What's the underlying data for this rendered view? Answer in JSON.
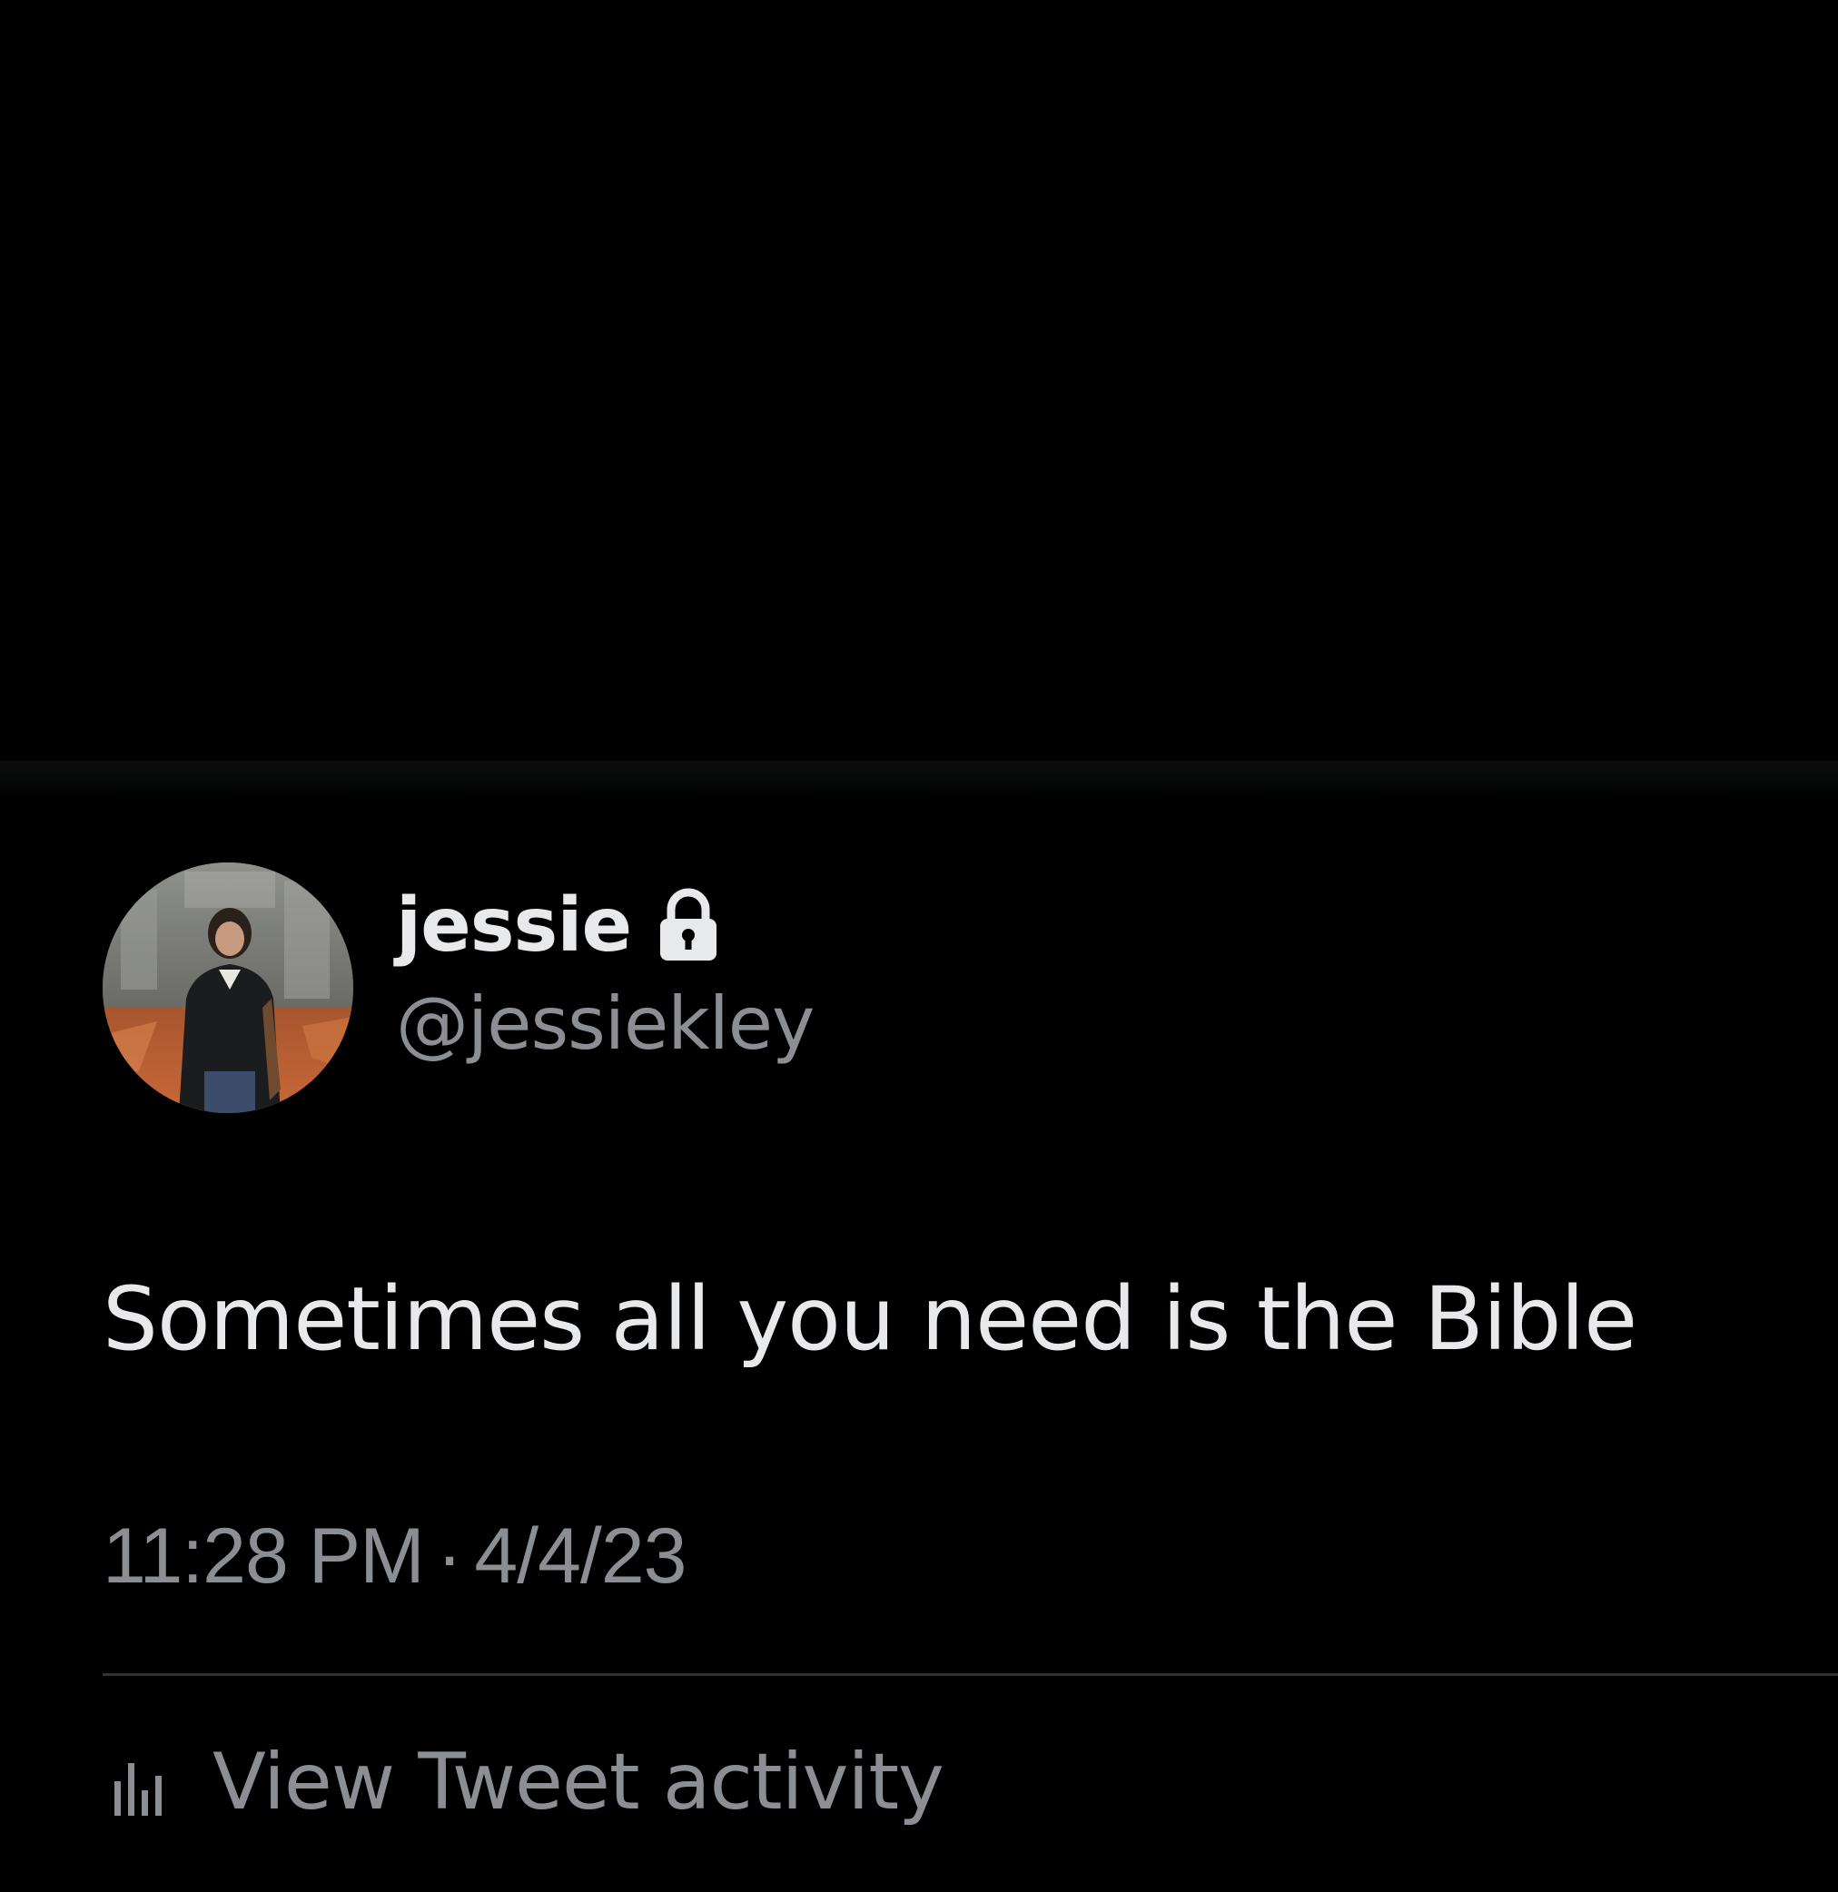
{
  "tweet": {
    "author": {
      "display_name": "jessie",
      "handle": "@jessiekley",
      "protected": true,
      "avatar_icon": "profile-photo"
    },
    "text": "Sometimes all you need is the Bible",
    "time": "11:28 PM",
    "separator": "·",
    "date": "4/4/23"
  },
  "actions": {
    "activity_label": "View Tweet activity",
    "activity_icon": "bar-chart-icon"
  },
  "colors": {
    "background": "#000000",
    "primary_text": "#e7e9ea",
    "secondary_text": "#8b8f93",
    "divider": "#2f3336"
  }
}
